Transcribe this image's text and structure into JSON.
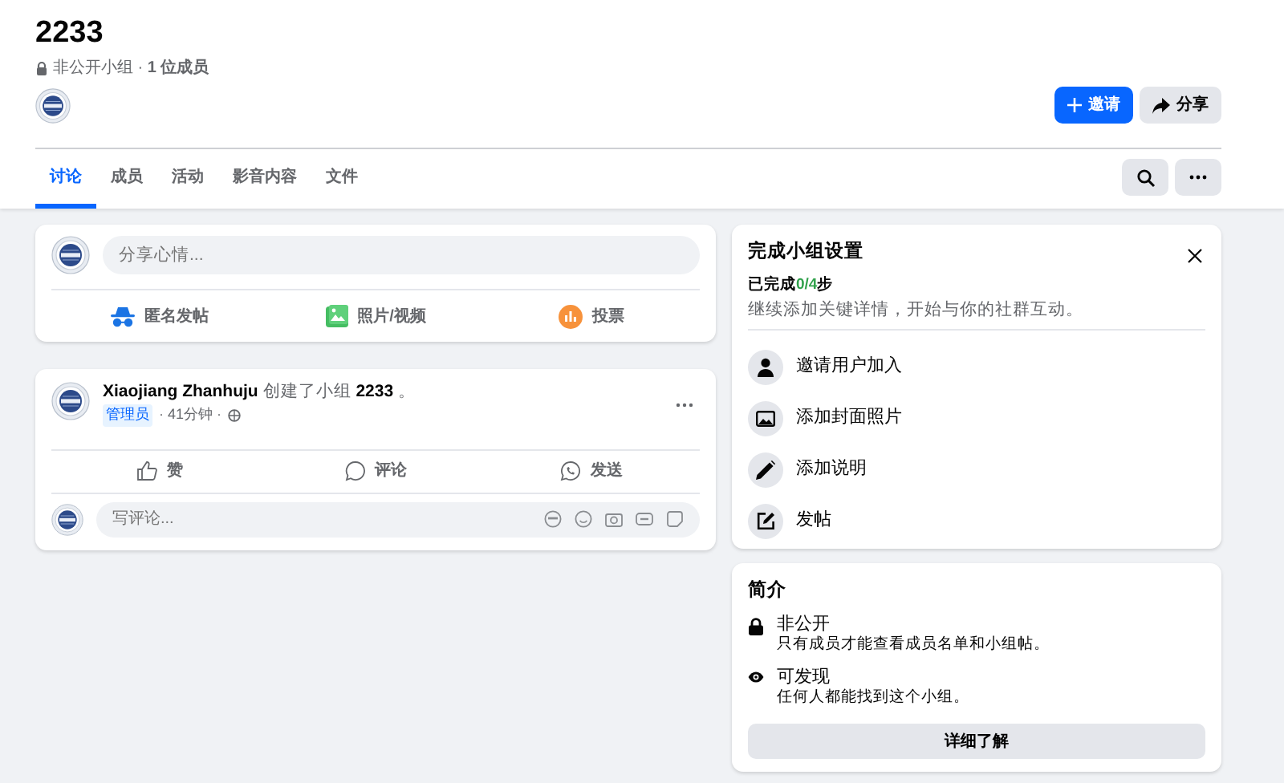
{
  "group": {
    "title": "2233",
    "subtitle": "非公开小组 · **1 位成员**"
  },
  "header_buttons": [
    {
      "kind": "primary",
      "label": "邀请"
    },
    {
      "kind": "secondary",
      "label": "分享"
    }
  ],
  "tabs": [
    {
      "label": "讨论",
      "selected": true
    },
    {
      "label": "成员",
      "selected": false
    },
    {
      "label": "活动",
      "selected": false
    },
    {
      "label": "影音内容",
      "selected": false
    },
    {
      "label": "文件",
      "selected": false
    }
  ],
  "composer": {
    "placeholder": "分享心情...",
    "actions": [
      {
        "kind": "anonymous",
        "label": "匿名发帖"
      },
      {
        "kind": "photo",
        "label": "照片/视频"
      },
      {
        "kind": "poll",
        "label": "投票"
      }
    ]
  },
  "post": {
    "headline": "**Xiaojiang Zhanhuju** 创建了小组 **2233** 。",
    "role_badge": "管理员",
    "time": "· 41分钟 ·",
    "actions": [
      {
        "kind": "like",
        "label": "赞"
      },
      {
        "kind": "comment",
        "label": "评论"
      },
      {
        "kind": "send",
        "label": "发送"
      }
    ],
    "comment_placeholder": "写评论..."
  },
  "setup": {
    "title": "完成小组设置",
    "progress_prefix": "已完成",
    "progress": "0/4",
    "progress_suffix": "步",
    "description": "继续添加关键详情，开始与你的社群互动。",
    "steps": [
      {
        "kind": "invite",
        "label": "邀请用户加入"
      },
      {
        "kind": "cover",
        "label": "添加封面照片"
      },
      {
        "kind": "describe",
        "label": "添加说明"
      },
      {
        "kind": "post",
        "label": "发帖"
      }
    ]
  },
  "about": {
    "title": "简介",
    "items": [
      {
        "kind": "private",
        "title": "非公开",
        "text": "只有成员才能查看成员名单和小组帖。"
      },
      {
        "kind": "visible",
        "title": "可发现",
        "text": "任何人都能找到这个小组。"
      }
    ],
    "button": "详细了解"
  }
}
